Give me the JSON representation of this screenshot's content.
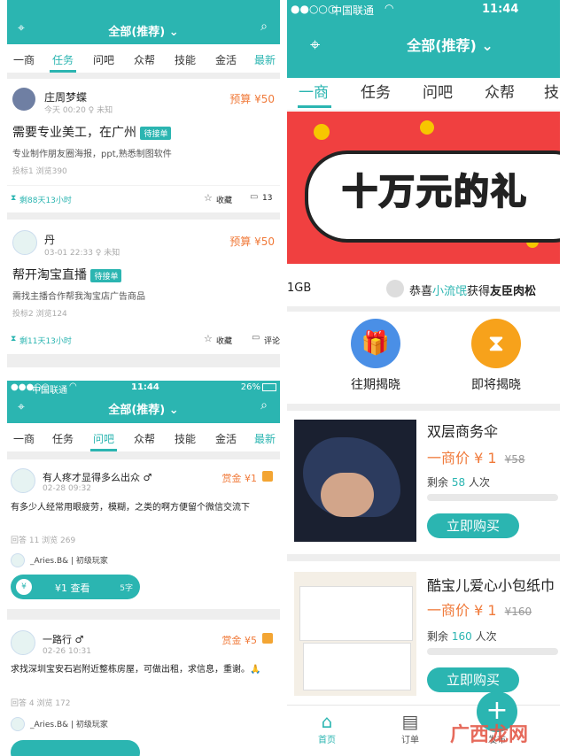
{
  "colors": {
    "teal": "#2bb5b1",
    "orange": "#f07a3a",
    "gray": "#aaaaaa"
  },
  "p1": {
    "nav_title": "全部(推荐)",
    "tabs": [
      "一商",
      "任务",
      "问吧",
      "众帮",
      "技能",
      "金活",
      "最新"
    ],
    "posts": [
      {
        "user": "庄周梦蝶",
        "meta": "今天 00:20  ♀ 未知",
        "budget": "预算 ¥50",
        "title": "需要专业美工，在广州",
        "badge": "待接单",
        "desc": "专业制作朋友圈海报，ppt,熟悉制图软件",
        "stats": "投标1  浏览390",
        "time": "剩88天13小时",
        "fav": "收藏",
        "comments": "13"
      },
      {
        "user": "丹",
        "meta": "03-01 22:33  ♀ 未知",
        "budget": "预算 ¥50",
        "title": "帮开淘宝直播",
        "badge": "待接单",
        "desc": "需找主播合作帮我淘宝店广告商品",
        "stats": "投标2  浏览124",
        "time": "剩11天13小时",
        "fav": "收藏",
        "comments": "评论"
      }
    ]
  },
  "p2": {
    "status": {
      "carrier": "中国联通",
      "time": "11:44",
      "battery": "26%"
    },
    "nav_title": "全部(推荐)",
    "tabs": [
      "一商",
      "任务",
      "问吧",
      "众帮",
      "技能",
      "金活",
      "最新"
    ],
    "posts": [
      {
        "user": "有人疼才显得多么出众 ♂",
        "time": "02-28 09:32",
        "reward": "赏金 ¥1",
        "text": "有多少人经常用眼疲劳，模糊，之类的啊方便留个微信交流下",
        "stats": "回答 11  浏览 269",
        "answerer": "_Aries.B& | 初级玩家",
        "view_btn": "¥1 查看",
        "view_count": "5字"
      },
      {
        "user": "一路行 ♂",
        "time": "02-26 10:31",
        "reward": "赏金 ¥5",
        "text": "求找深圳宝安石岩附近整栋房屋，可做出租，求信息，重谢。🙏",
        "stats": "回答 4  浏览 172",
        "answerer": "_Aries.B& | 初级玩家"
      }
    ]
  },
  "p3": {
    "status": {
      "carrier": "中国联通",
      "time": "11:44"
    },
    "nav_title": "全部(推荐)",
    "tabs": [
      "一商",
      "任务",
      "问吧",
      "众帮",
      "技"
    ],
    "banner_text": "十万元的礼",
    "marquee_left": "1GB",
    "marquee": {
      "prefix": "恭喜",
      "name": "小流氓",
      "verb": "获得",
      "prize": "友臣肉松"
    },
    "icons": [
      {
        "label": "往期揭晓"
      },
      {
        "label": "即将揭晓"
      }
    ],
    "products": [
      {
        "name": "双层商务伞",
        "price_label": "一商价 ¥ 1",
        "orig": "¥58",
        "remain_prefix": "剩余",
        "remain": "58",
        "remain_suffix": "人次",
        "buy": "立即购买"
      },
      {
        "name": "酷宝儿爱心小包纸巾",
        "price_label": "一商价 ¥ 1",
        "orig": "¥160",
        "remain_prefix": "剩余",
        "remain": "160",
        "remain_suffix": "人次",
        "buy": "立即购买"
      }
    ],
    "bottom_nav": [
      {
        "label": "首页"
      },
      {
        "label": "订单"
      },
      {
        "label": "发布"
      }
    ]
  },
  "watermark": "广西龙网"
}
